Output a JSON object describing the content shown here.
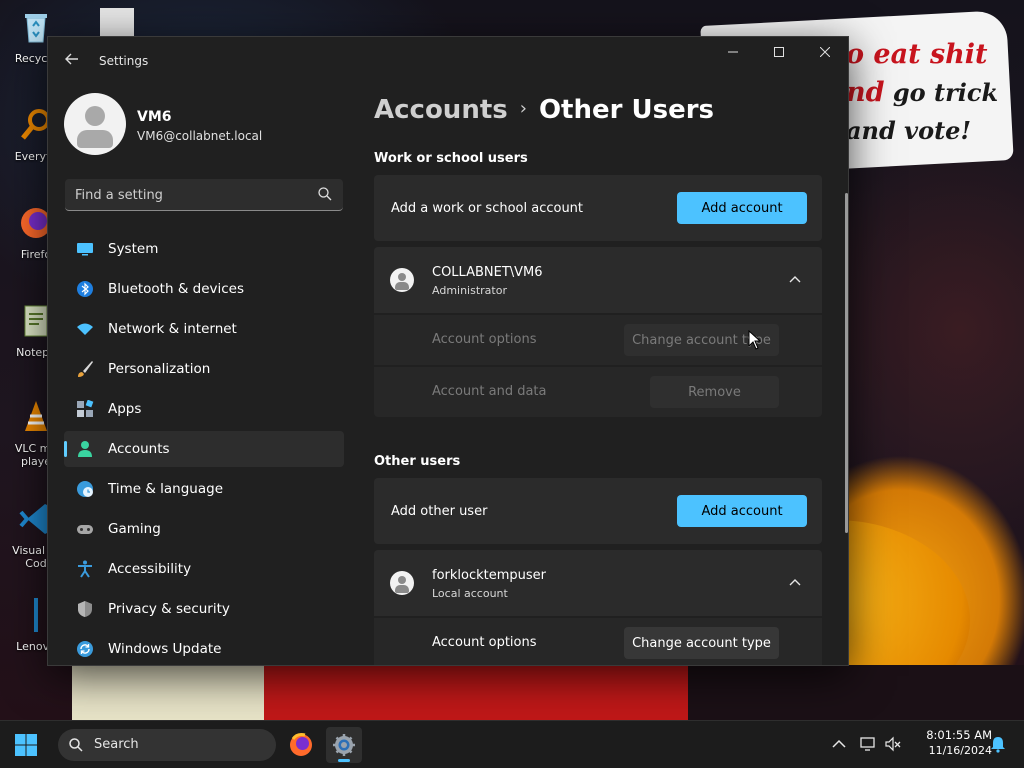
{
  "desktop": {
    "icons": [
      {
        "label": "Recycle"
      },
      {
        "label": "Everyth"
      },
      {
        "label": "Firefo"
      },
      {
        "label": "Notepa"
      },
      {
        "label": "VLC me\nplaye"
      },
      {
        "label": "Visual St\nCod"
      },
      {
        "label": "Lenovo"
      }
    ],
    "note_line1": "o eat shit",
    "note_line2a": "nd",
    "note_line2b": " go trick",
    "note_line3": "and vote!"
  },
  "window": {
    "app_title": "Settings",
    "back_icon": "arrow-left-icon"
  },
  "profile": {
    "name": "VM6",
    "email": "VM6@collabnet.local"
  },
  "search": {
    "placeholder": "Find a setting"
  },
  "nav": {
    "items": [
      {
        "label": "System",
        "icon": "monitor-icon",
        "color": "#4cc2ff"
      },
      {
        "label": "Bluetooth & devices",
        "icon": "bluetooth-icon",
        "color": "#1e90ff"
      },
      {
        "label": "Network & internet",
        "icon": "wifi-icon",
        "color": "#4cc2ff"
      },
      {
        "label": "Personalization",
        "icon": "brush-icon",
        "color": "#e8a23c"
      },
      {
        "label": "Apps",
        "icon": "apps-icon",
        "color": "#9aa7b8"
      },
      {
        "label": "Accounts",
        "icon": "person-icon",
        "color": "#3ad4a0"
      },
      {
        "label": "Time & language",
        "icon": "globe-clock-icon",
        "color": "#3a9bdc"
      },
      {
        "label": "Gaming",
        "icon": "gamepad-icon",
        "color": "#9a9a9a"
      },
      {
        "label": "Accessibility",
        "icon": "accessibility-icon",
        "color": "#3a9bdc"
      },
      {
        "label": "Privacy & security",
        "icon": "shield-icon",
        "color": "#8d8d8d"
      },
      {
        "label": "Windows Update",
        "icon": "sync-icon",
        "color": "#3a9bdc"
      }
    ],
    "active_index": 5
  },
  "main": {
    "breadcrumb_parent": "Accounts",
    "breadcrumb_sep": "›",
    "breadcrumb_current": "Other Users",
    "work_section": {
      "title": "Work or school users",
      "add_label": "Add a work or school account",
      "add_button": "Add account",
      "user": {
        "name": "COLLABNET\\VM6",
        "role": "Administrator",
        "options_label": "Account options",
        "options_button": "Change account type",
        "data_label": "Account and data",
        "data_button": "Remove"
      }
    },
    "other_section": {
      "title": "Other users",
      "add_label": "Add other user",
      "add_button": "Add account",
      "user": {
        "name": "forklocktempuser",
        "role": "Local account",
        "options_label": "Account options",
        "options_button": "Change account type"
      }
    }
  },
  "taskbar": {
    "search_label": "Search",
    "time": "8:01:55 AM",
    "date": "11/16/2024"
  },
  "colors": {
    "accent": "#4cc2ff",
    "window_bg": "#202020",
    "card_bg": "#2b2b2b"
  }
}
